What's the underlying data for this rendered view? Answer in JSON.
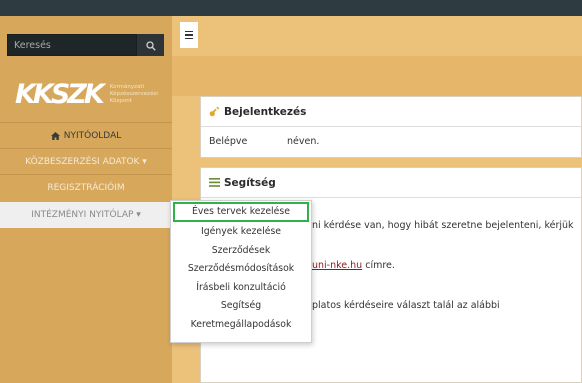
{
  "search": {
    "placeholder": "Keresés"
  },
  "logo": {
    "mark": "KKSZK",
    "line1": "Kormányzati",
    "line2": "Képzésszervezési",
    "line3": "Központ"
  },
  "nav": {
    "home": "NYITÓOLDAL",
    "kozbeszerzesi": "KÖZBESZERZÉSI ADATOK ▾",
    "regisztracioim": "REGISZTRÁCIÓIM",
    "intezmenyi": "INTÉZMÉNYI NYITÓLAP ▾"
  },
  "dropdown": {
    "items": [
      "Éves tervek kezelése",
      "Igények kezelése",
      "Szerződések",
      "Szerződésmódosítások",
      "Írásbeli konzultáció",
      "Segítség",
      "Keretmegállapodások"
    ]
  },
  "login_panel": {
    "title": "Bejelentkezés",
    "label": "Belépve",
    "value": "néven."
  },
  "help_panel": {
    "title": "Segítség",
    "line1": "ni kérdése van, hogy hibát szeretne bejelenteni, kérjük",
    "link": "uni-nke.hu",
    "line2_suffix": " címre.",
    "line3": "platos kérdéseire választ talál az alábbi"
  },
  "colors": {
    "sidebar": "#d7a85c",
    "main": "#ecc27a",
    "topbar": "#2e3b40",
    "active_border": "#2fb24a",
    "link": "#8a1a1a"
  },
  "icons": {
    "search": "search-icon",
    "home": "home-icon",
    "key": "key-icon",
    "help": "list-icon",
    "menu": "hamburger-icon"
  }
}
